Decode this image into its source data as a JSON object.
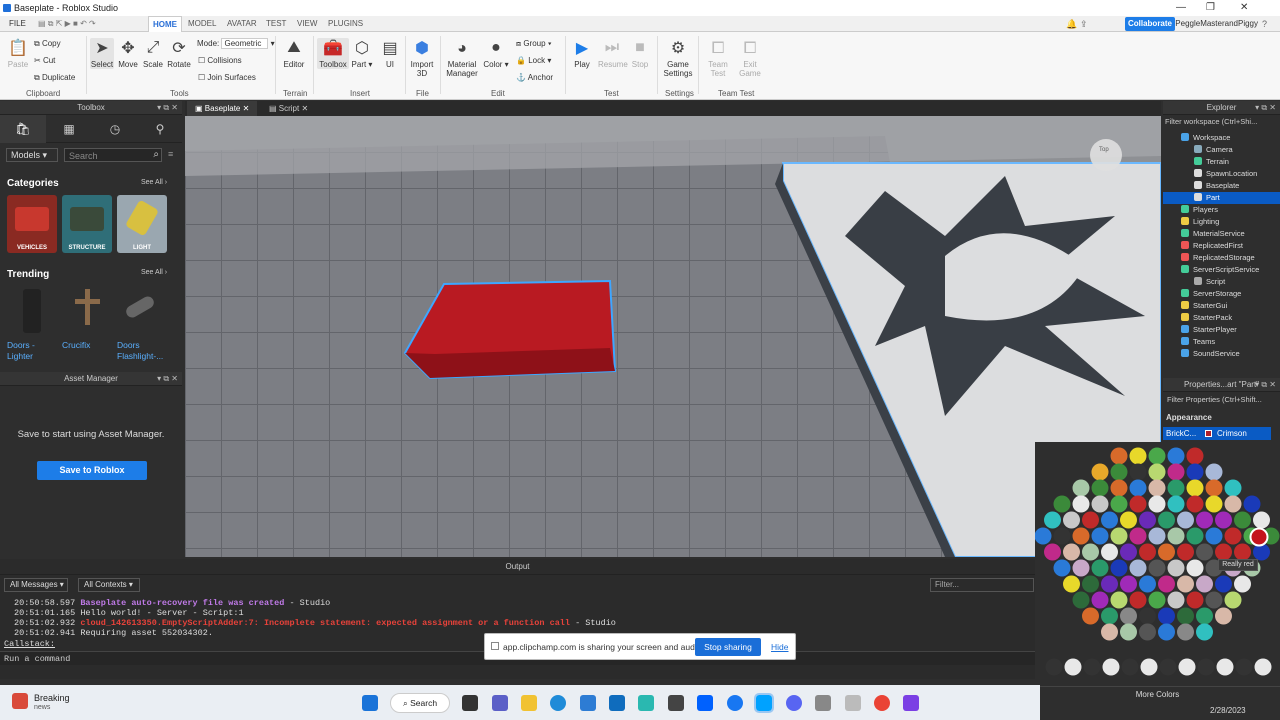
{
  "window": {
    "title": "Baseplate - Roblox Studio"
  },
  "menu": {
    "file": "FILE",
    "tabs": [
      "HOME",
      "MODEL",
      "AVATAR",
      "TEST",
      "VIEW",
      "PLUGINS"
    ],
    "collaborate": "Collaborate",
    "user": "PeggleMasterandPiggy"
  },
  "ribbon": {
    "paste": "Paste",
    "copy": "Copy",
    "cut": "Cut",
    "duplicate": "Duplicate",
    "clipboard": "Clipboard",
    "select": "Select",
    "move": "Move",
    "scale": "Scale",
    "rotate": "Rotate",
    "tools": "Tools",
    "mode_label": "Mode:",
    "mode_value": "Geometric",
    "collisions": "Collisions",
    "join_surfaces": "Join Surfaces",
    "editor": "Editor",
    "terrain": "Terrain",
    "toolbox": "Toolbox",
    "part": "Part",
    "ui": "UI",
    "insert": "Insert",
    "import3d": "Import 3D",
    "file": "File",
    "material_manager": "Material Manager",
    "color": "Color",
    "group": "Group",
    "lock": "Lock",
    "anchor": "Anchor",
    "edit": "Edit",
    "play": "Play",
    "resume": "Resume",
    "stop": "Stop",
    "test": "Test",
    "game_settings": "Game Settings",
    "settings": "Settings",
    "team_test": "Team Test",
    "exit_game": "Exit Game",
    "team_test_group": "Team Test"
  },
  "toolbox": {
    "title": "Toolbox",
    "dropdown": "Models",
    "search_placeholder": "Search",
    "categories_title": "Categories",
    "see_all": "See All",
    "categories": [
      {
        "label": "VEHICLES",
        "color": "#b8322a"
      },
      {
        "label": "STRUCTURE",
        "color": "#3a8a8a"
      },
      {
        "label": "LIGHT",
        "color": "#c8b040"
      }
    ],
    "trending_title": "Trending",
    "trending": [
      "Doors - Lighter",
      "Crucifix",
      "Doors Flashlight-..."
    ]
  },
  "asset_manager": {
    "title": "Asset Manager",
    "message": "Save to start using Asset Manager.",
    "button": "Save to Roblox"
  },
  "viewport": {
    "tabs": [
      "Baseplate",
      "Script"
    ],
    "gizmo": "Top"
  },
  "explorer": {
    "title": "Explorer",
    "filter": "Filter workspace (Ctrl+Shi...",
    "items": [
      {
        "label": "Workspace",
        "indent": 0,
        "color": "#4aa3e8"
      },
      {
        "label": "Camera",
        "indent": 1,
        "color": "#8ab"
      },
      {
        "label": "Terrain",
        "indent": 1,
        "color": "#4c9"
      },
      {
        "label": "SpawnLocation",
        "indent": 1,
        "color": "#ddd"
      },
      {
        "label": "Baseplate",
        "indent": 1,
        "color": "#ddd"
      },
      {
        "label": "Part",
        "indent": 1,
        "color": "#ddd",
        "selected": true
      },
      {
        "label": "Players",
        "indent": 0,
        "color": "#4c9"
      },
      {
        "label": "Lighting",
        "indent": 0,
        "color": "#ec4"
      },
      {
        "label": "MaterialService",
        "indent": 0,
        "color": "#4c9"
      },
      {
        "label": "ReplicatedFirst",
        "indent": 0,
        "color": "#e55"
      },
      {
        "label": "ReplicatedStorage",
        "indent": 0,
        "color": "#e55"
      },
      {
        "label": "ServerScriptService",
        "indent": 0,
        "color": "#4c9"
      },
      {
        "label": "Script",
        "indent": 1,
        "color": "#aaa"
      },
      {
        "label": "ServerStorage",
        "indent": 0,
        "color": "#4c9"
      },
      {
        "label": "StarterGui",
        "indent": 0,
        "color": "#ec4"
      },
      {
        "label": "StarterPack",
        "indent": 0,
        "color": "#ec4"
      },
      {
        "label": "StarterPlayer",
        "indent": 0,
        "color": "#4aa3e8"
      },
      {
        "label": "Teams",
        "indent": 0,
        "color": "#4aa3e8"
      },
      {
        "label": "SoundService",
        "indent": 0,
        "color": "#4aa3e8"
      }
    ]
  },
  "properties": {
    "title": "Properties...art \"Part\"",
    "filter": "Filter Properties (Ctrl+Shift...",
    "section": "Appearance",
    "prop": "BrickC...",
    "value": "Crimson",
    "value_color": "#b0202a"
  },
  "output": {
    "title": "Output",
    "all_messages": "All Messages",
    "all_contexts": "All Contexts",
    "filter": "Filter...",
    "lines": [
      {
        "time": "20:50:58.597",
        "text": "Baseplate auto-recovery file was created",
        "suffix": "  -  Studio",
        "color": "#c07ae8"
      },
      {
        "time": "20:51:01.165",
        "text": "Hello world!  -  Server - Script:1",
        "suffix": "",
        "color": "#dddddd"
      },
      {
        "time": "20:51:02.932",
        "text": "cloud_142613350.EmptyScriptAdder:7: Incomplete statement: expected assignment or a function call",
        "suffix": "  -  Studio",
        "color": "#e8423a"
      },
      {
        "time": "20:51:02.941",
        "text": "Requiring asset 552034302.",
        "suffix": "",
        "color": "#dddddd"
      }
    ],
    "callstack": "Callstack:",
    "command": "Run a command"
  },
  "share": {
    "message": "app.clipchamp.com is sharing your screen and audio.",
    "stop": "Stop sharing",
    "hide": "Hide"
  },
  "palette": {
    "tooltip": "Really red",
    "more_colors": "More Colors"
  },
  "taskbar": {
    "news_title": "Breaking",
    "news_sub": "news",
    "search": "Search",
    "date": "2/28/2023"
  }
}
